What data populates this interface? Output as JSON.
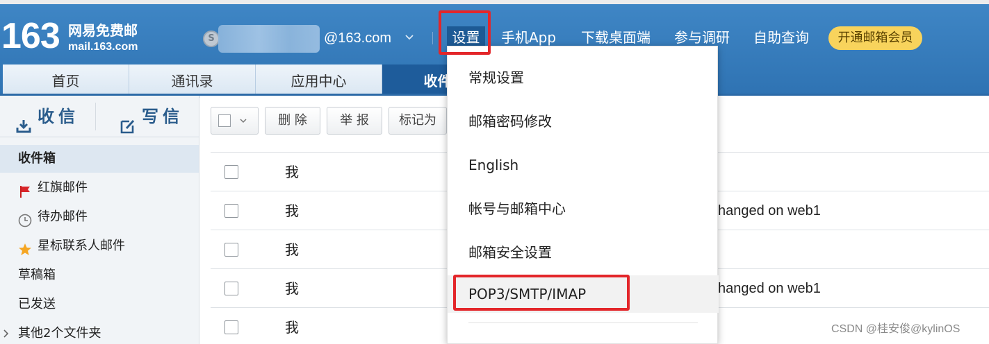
{
  "header": {
    "logo_number": "163",
    "logo_name": "网易免费邮",
    "logo_url": "mail.163.com",
    "account_domain": "@163.com",
    "nav": {
      "settings": "设置",
      "mobile_app": "手机App",
      "desktop": "下载桌面端",
      "survey": "参与调研",
      "self_service": "自助查询",
      "vip": "开通邮箱会员"
    },
    "tabs": [
      {
        "label": "首页"
      },
      {
        "label": "通讯录"
      },
      {
        "label": "应用中心"
      },
      {
        "label": "收件"
      }
    ]
  },
  "sidebar": {
    "receive_label": "收信",
    "compose_label": "写信",
    "items": [
      {
        "label": "收件箱"
      },
      {
        "label": "红旗邮件"
      },
      {
        "label": "待办邮件"
      },
      {
        "label": "星标联系人邮件"
      },
      {
        "label": "草稿箱"
      },
      {
        "label": "已发送"
      },
      {
        "label": "其他2个文件夹"
      }
    ]
  },
  "toolbar": {
    "delete_label": "删 除",
    "report_label": "举 报",
    "mark_label": "标记为"
  },
  "mail_list": {
    "rows": [
      {
        "from": "我",
        "subject": ""
      },
      {
        "from": "我",
        "subject": "hanged on web1"
      },
      {
        "from": "我",
        "subject": ""
      },
      {
        "from": "我",
        "subject": "hanged on web1"
      },
      {
        "from": "我",
        "subject": ""
      }
    ]
  },
  "settings_menu": {
    "items": [
      {
        "label": "常规设置"
      },
      {
        "label": "邮箱密码修改"
      },
      {
        "label": "English"
      },
      {
        "label": "帐号与邮箱中心"
      },
      {
        "label": "邮箱安全设置"
      },
      {
        "label": "POP3/SMTP/IMAP"
      }
    ]
  },
  "watermark": "CSDN @桂安俊@kylinOS",
  "colors": {
    "header_blue": "#3f86c5",
    "active_blue": "#1e5c9b",
    "vip_yellow": "#f8d35c",
    "highlight_red": "#e3262a"
  }
}
